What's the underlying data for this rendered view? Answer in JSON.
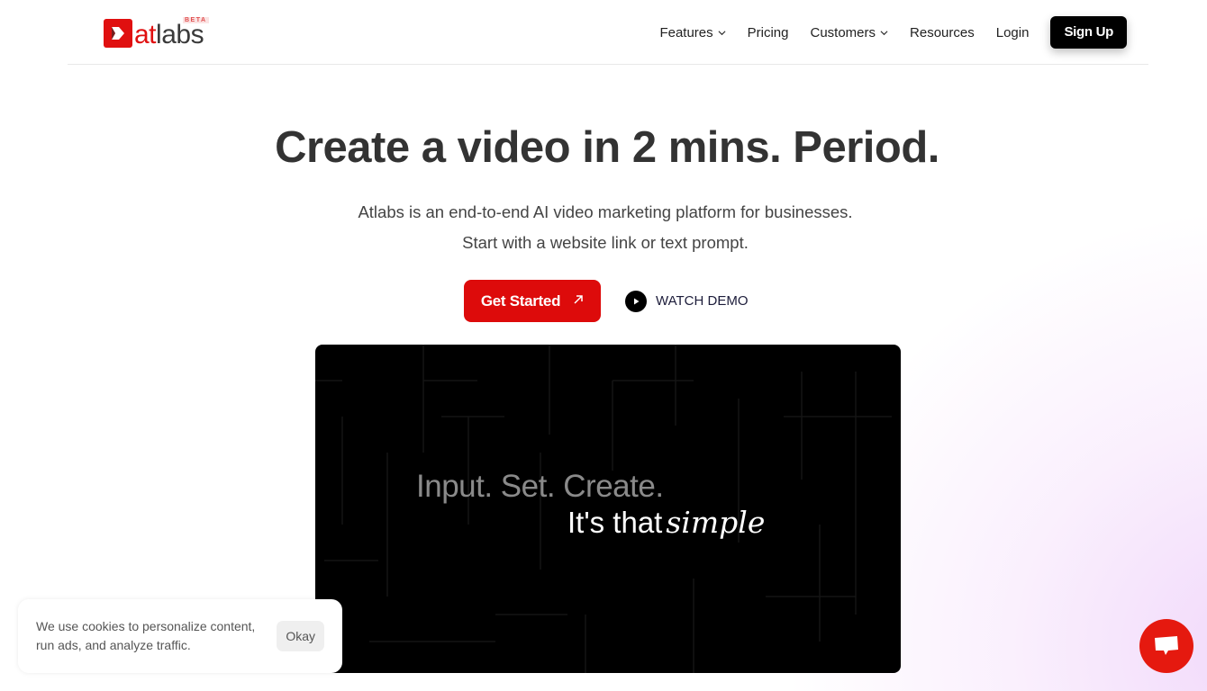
{
  "header": {
    "logo": {
      "text_accent": "at",
      "text_main": "labs",
      "badge": "BETA",
      "brand_color": "#e01010"
    },
    "nav": [
      {
        "label": "Features",
        "has_dropdown": true
      },
      {
        "label": "Pricing",
        "has_dropdown": false
      },
      {
        "label": "Customers",
        "has_dropdown": true
      },
      {
        "label": "Resources",
        "has_dropdown": false
      },
      {
        "label": "Login",
        "has_dropdown": false
      }
    ],
    "signup_label": "Sign Up"
  },
  "hero": {
    "title": "Create a video in 2 mins. Period.",
    "subtitle_line1": "Atlabs is an end-to-end AI video marketing platform for businesses.",
    "subtitle_line2": "Start with a website link or text prompt.",
    "primary_cta": "Get Started",
    "primary_cta_icon": "arrow-up-right-icon",
    "secondary_cta": "WATCH DEMO",
    "secondary_cta_icon": "play-icon"
  },
  "video": {
    "line1": "Input. Set. Create.",
    "line2_plain": "It's that",
    "line2_italic": "simple"
  },
  "cookie_banner": {
    "text": "We use cookies to personalize content, run ads, and analyze traffic.",
    "button_label": "Okay"
  },
  "chat_widget": {
    "icon": "chat-bubble-icon",
    "color": "#e5190f"
  }
}
